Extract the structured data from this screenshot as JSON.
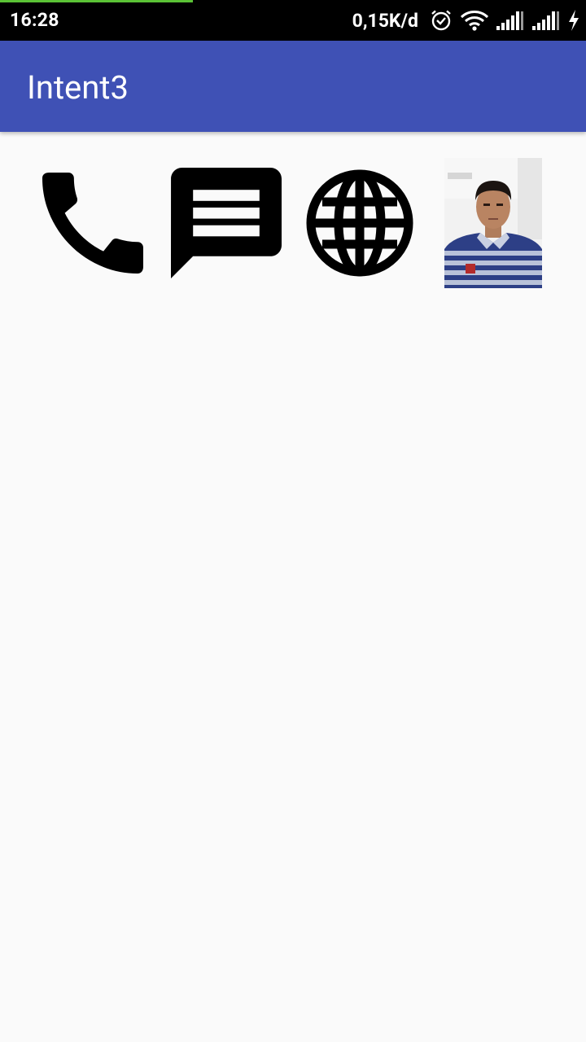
{
  "status_bar": {
    "time": "16:28",
    "net_speed": "0,15K/d",
    "icons": [
      "alarm-icon",
      "wifi-icon",
      "signal-icon",
      "signal-icon",
      "charging-icon"
    ],
    "progress_color": "#5bc236"
  },
  "app_bar": {
    "title": "Intent3",
    "color": "#3f51b5"
  },
  "actions": [
    {
      "icon": "phone-icon"
    },
    {
      "icon": "message-icon"
    },
    {
      "icon": "globe-icon"
    },
    {
      "icon": "profile-photo"
    }
  ]
}
